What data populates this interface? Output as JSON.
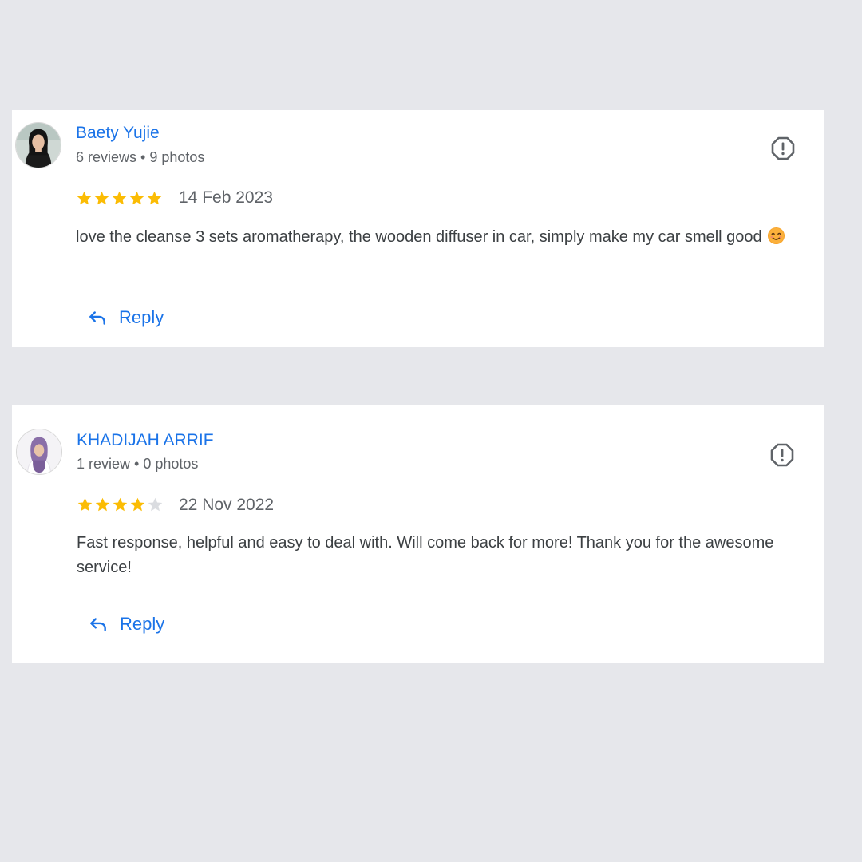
{
  "reviews": [
    {
      "author": "Baety Yujie",
      "meta": "6 reviews • 9 photos",
      "rating": 5,
      "date": "14 Feb 2023",
      "text": "love the cleanse 3 sets aromatherapy, the wooden diffuser in car, simply make my car smell good",
      "text_emoji": "smiling-face-icon",
      "reply_label": "Reply"
    },
    {
      "author": "KHADIJAH ARRIF",
      "meta": "1 review • 0 photos",
      "rating": 4,
      "date": "22 Nov 2022",
      "text": "Fast response, helpful and easy to deal with. Will come back for more! Thank you for the awesome service!",
      "reply_label": "Reply"
    }
  ],
  "colors": {
    "background": "#e6e7eb",
    "link": "#1a73e8",
    "star_filled": "#fbbc04",
    "star_empty": "#dadce0",
    "text": "#3c4043",
    "secondary": "#5f6368"
  },
  "icons": {
    "flag": "report-icon",
    "reply": "reply-arrow-icon",
    "star": "star-icon"
  }
}
